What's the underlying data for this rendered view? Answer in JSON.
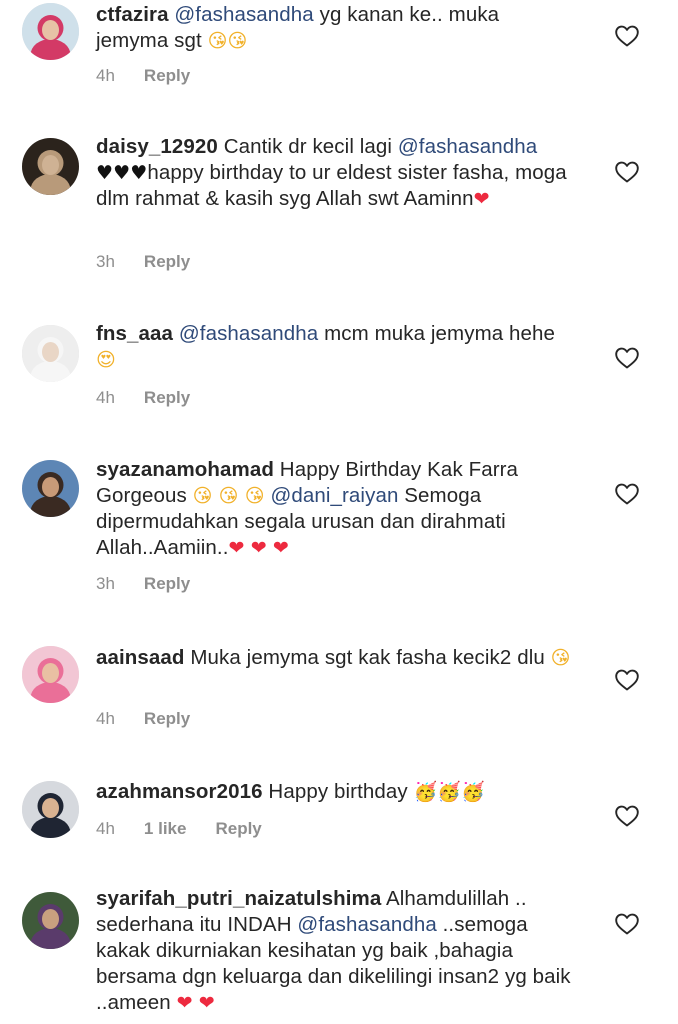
{
  "comments": [
    {
      "username": "ctfazira",
      "parts": [
        {
          "t": "mention",
          "v": "@fashasandha"
        },
        {
          "t": "text",
          "v": " yg kanan ke.. muka jemyma sgt "
        },
        {
          "t": "emoji",
          "v": "😘",
          "cls": "kiss"
        },
        {
          "t": "emoji",
          "v": "😘",
          "cls": "kiss"
        }
      ],
      "time": "4h",
      "reply": "Reply",
      "avatar": {
        "bg": "#cfe0ea",
        "skin": "#e7c2a6",
        "hair": "#d33a66"
      }
    },
    {
      "username": "daisy_12920",
      "parts": [
        {
          "t": "text",
          "v": " Cantik dr kecil lagi "
        },
        {
          "t": "mention",
          "v": "@fashasandha"
        },
        {
          "t": "text",
          "v": " "
        },
        {
          "t": "emoji",
          "v": "♥♥♥",
          "cls": "black"
        },
        {
          "t": "text",
          "v": "happy birthday to ur eldest sister fasha, moga dlm rahmat & kasih syg Allah swt Aaminn"
        },
        {
          "t": "emoji",
          "v": "❤",
          "cls": "red"
        }
      ],
      "time": "3h",
      "reply": "Reply",
      "avatar": {
        "bg": "#2b231c",
        "skin": "#cfb294",
        "hair": "#b89a7a"
      }
    },
    {
      "username": "fns_aaa",
      "parts": [
        {
          "t": "text",
          "v": " "
        },
        {
          "t": "mention",
          "v": "@fashasandha"
        },
        {
          "t": "text",
          "v": " mcm muka jemyma hehe"
        },
        {
          "t": "emoji",
          "v": "😍",
          "cls": "kiss"
        }
      ],
      "time": "4h",
      "reply": "Reply",
      "avatar": {
        "bg": "#eeeeee",
        "skin": "#e9d6c6",
        "hair": "#f6f6f6"
      }
    },
    {
      "username": "syazanamohamad",
      "parts": [
        {
          "t": "text",
          "v": " Happy Birthday Kak Farra Gorgeous "
        },
        {
          "t": "emoji",
          "v": "😘 😘 😘",
          "cls": "kiss"
        },
        {
          "t": "text",
          "v": " "
        },
        {
          "t": "mention",
          "v": "@dani_raiyan"
        },
        {
          "t": "text",
          "v": " Semoga dipermudahkan segala urusan dan dirahmati Allah..Aamiin.."
        },
        {
          "t": "emoji",
          "v": "❤ ❤ ❤",
          "cls": "red"
        }
      ],
      "time": "3h",
      "reply": "Reply",
      "avatar": {
        "bg": "#5d86b5",
        "skin": "#c89a78",
        "hair": "#3a2a22"
      }
    },
    {
      "username": "aainsaad",
      "parts": [
        {
          "t": "text",
          "v": " Muka jemyma sgt kak fasha kecik2 dlu "
        },
        {
          "t": "emoji",
          "v": "😘",
          "cls": "kiss"
        }
      ],
      "time": "4h",
      "reply": "Reply",
      "avatar": {
        "bg": "#f2c6d4",
        "skin": "#e9c0a3",
        "hair": "#ea6f98"
      }
    },
    {
      "username": "azahmansor2016",
      "parts": [
        {
          "t": "text",
          "v": " Happy birthday "
        },
        {
          "t": "emoji",
          "v": "🥳🥳🥳",
          "cls": "party"
        }
      ],
      "time": "4h",
      "likes": "1 like",
      "reply": "Reply",
      "avatar": {
        "bg": "#d6d9de",
        "skin": "#d9b291",
        "hair": "#1f2533"
      }
    },
    {
      "username": "syarifah_putri_naizatulshima",
      "parts": [
        {
          "t": "text",
          "v": " Alhamdulillah .. sederhana itu INDAH "
        },
        {
          "t": "mention",
          "v": "@fashasandha"
        },
        {
          "t": "text",
          "v": " ..semoga kakak dikurniakan kesihatan yg baik ,bahagia bersama dgn keluarga dan dikelilingi insan2 yg baik ..ameen "
        },
        {
          "t": "emoji",
          "v": "❤ ❤",
          "cls": "red"
        }
      ],
      "avatar": {
        "bg": "#3f5a3a",
        "skin": "#c9a07f",
        "hair": "#5a3b6b"
      }
    }
  ]
}
